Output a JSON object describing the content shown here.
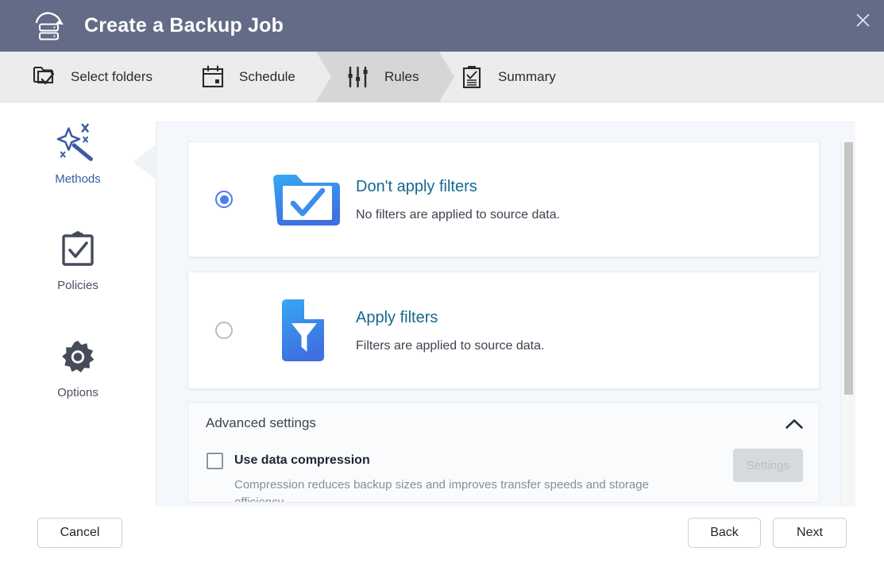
{
  "window": {
    "title": "Create a Backup Job",
    "title_icon": "backup-server-icon",
    "close_icon": "close-icon",
    "header_bg": "#646b87"
  },
  "steps": [
    {
      "id": "select-folders",
      "label": "Select folders",
      "icon": "folder-check-icon",
      "active": false
    },
    {
      "id": "schedule",
      "label": "Schedule",
      "icon": "calendar-icon",
      "active": false
    },
    {
      "id": "rules",
      "label": "Rules",
      "icon": "sliders-icon",
      "active": true
    },
    {
      "id": "summary",
      "label": "Summary",
      "icon": "clipboard-list-icon",
      "active": false
    }
  ],
  "sidebar": {
    "items": [
      {
        "id": "methods",
        "label": "Methods",
        "icon": "magic-wand-icon",
        "selected": true
      },
      {
        "id": "policies",
        "label": "Policies",
        "icon": "clipboard-check-icon",
        "selected": false
      },
      {
        "id": "options",
        "label": "Options",
        "icon": "gear-icon",
        "selected": false
      }
    ]
  },
  "main": {
    "options": [
      {
        "id": "dont-apply-filters",
        "title": "Don't apply filters",
        "description": "No filters are applied to source data.",
        "icon": "folder-check-blue-icon",
        "selected": true
      },
      {
        "id": "apply-filters",
        "title": "Apply filters",
        "description": "Filters are applied to source data.",
        "icon": "file-funnel-blue-icon",
        "selected": false
      }
    ],
    "advanced": {
      "heading": "Advanced settings",
      "expanded": true,
      "collapse_icon": "chevron-up-icon",
      "checkbox": {
        "label": "Use data compression",
        "checked": false,
        "description": "Compression reduces backup sizes and improves transfer speeds and storage efficiency."
      },
      "settings_button": {
        "label": "Settings",
        "disabled": true
      }
    }
  },
  "footer": {
    "cancel": "Cancel",
    "back": "Back",
    "next": "Next"
  },
  "colors": {
    "accent_blue": "#4a7ef0",
    "title_link": "#15688f",
    "header": "#646b87",
    "panel_bg": "#f4f7fb"
  }
}
